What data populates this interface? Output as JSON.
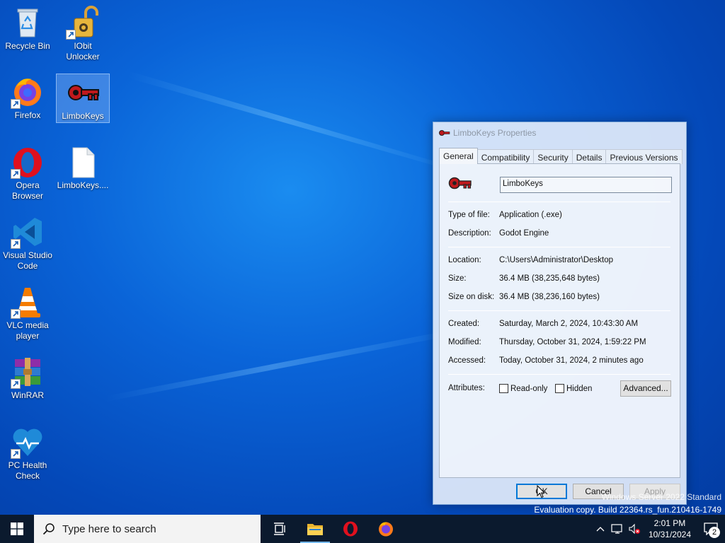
{
  "desktop": {
    "icons": [
      {
        "label": "Recycle Bin"
      },
      {
        "label": "IObit Unlocker"
      },
      {
        "label": "Firefox"
      },
      {
        "label": "LimboKeys"
      },
      {
        "label": "Opera Browser"
      },
      {
        "label": "LimboKeys...."
      },
      {
        "label": "Visual Studio Code"
      },
      {
        "label": "VLC media player"
      },
      {
        "label": "WinRAR"
      },
      {
        "label": "PC Health Check"
      }
    ]
  },
  "dialog": {
    "title": "LimboKeys Properties",
    "tabs": [
      "General",
      "Compatibility",
      "Security",
      "Details",
      "Previous Versions"
    ],
    "active_tab": "General",
    "file_name": "LimboKeys",
    "fields": {
      "type_label": "Type of file:",
      "type_value": "Application (.exe)",
      "desc_label": "Description:",
      "desc_value": "Godot Engine",
      "location_label": "Location:",
      "location_value": "C:\\Users\\Administrator\\Desktop",
      "size_label": "Size:",
      "size_value": "36.4 MB (38,235,648 bytes)",
      "disk_label": "Size on disk:",
      "disk_value": "36.4 MB (38,236,160 bytes)",
      "created_label": "Created:",
      "created_value": "Saturday, March 2, 2024, 10:43:30 AM",
      "modified_label": "Modified:",
      "modified_value": "Thursday, October 31, 2024, 1:59:22 PM",
      "accessed_label": "Accessed:",
      "accessed_value": "Today, October 31, 2024, 2 minutes ago"
    },
    "attributes_label": "Attributes:",
    "readonly_label": "Read-only",
    "readonly_checked": false,
    "hidden_label": "Hidden",
    "hidden_checked": false,
    "advanced_label": "Advanced...",
    "ok_label": "OK",
    "cancel_label": "Cancel",
    "apply_label": "Apply"
  },
  "watermark": {
    "line1": "Windows Server 2022 Standard",
    "line2": "Evaluation copy. Build 22364.rs_fun.210416-1749"
  },
  "taskbar": {
    "search_placeholder": "Type here to search",
    "time": "2:01 PM",
    "date": "10/31/2024",
    "notification_count": "2"
  },
  "colors": {
    "accent": "#0078d7",
    "taskbar": "#0b1a2e"
  }
}
